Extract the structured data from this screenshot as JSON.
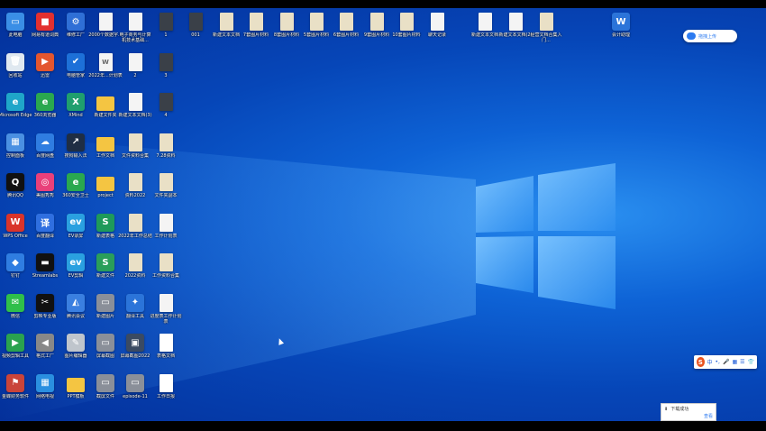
{
  "desktop": {
    "icons": [
      {
        "label": "此电脑",
        "kind": "app",
        "color": "#3a8ee6",
        "glyph": "▭"
      },
      {
        "label": "网易有道词典",
        "kind": "app",
        "color": "#e3302f",
        "glyph": "■"
      },
      {
        "label": "维修工厂",
        "kind": "app",
        "color": "#2f6fd6",
        "glyph": "⚙"
      },
      {
        "label": "2000个数据字...",
        "kind": "doc",
        "color": "#f4f4f4",
        "glyph": ""
      },
      {
        "label": "电子商务与计算机技术基础...",
        "kind": "doc",
        "color": "#f4f4f4",
        "glyph": ""
      },
      {
        "label": "1",
        "kind": "dark",
        "color": "#3a4048",
        "glyph": ""
      },
      {
        "label": "001",
        "kind": "dark",
        "color": "#3a4048",
        "glyph": ""
      },
      {
        "label": "新建文本文档",
        "kind": "zip",
        "color": "#e9e0c6",
        "glyph": ""
      },
      {
        "label": "7套图片材料",
        "kind": "zip",
        "color": "#e9e0c6",
        "glyph": ""
      },
      {
        "label": "8套图片材料",
        "kind": "zip",
        "color": "#e9e0c6",
        "glyph": ""
      },
      {
        "label": "5套图片材料",
        "kind": "zip",
        "color": "#e9e0c6",
        "glyph": ""
      },
      {
        "label": "6套图片材料",
        "kind": "zip",
        "color": "#e9e0c6",
        "glyph": ""
      },
      {
        "label": "9套图片材料",
        "kind": "zip",
        "color": "#e9e0c6",
        "glyph": ""
      },
      {
        "label": "10套图片材料",
        "kind": "zip",
        "color": "#e9e0c6",
        "glyph": ""
      },
      {
        "label": "聊天记录",
        "kind": "doc",
        "color": "#f4f4f4",
        "glyph": ""
      },
      {
        "label": "新建文本文档",
        "kind": "doc",
        "color": "#f4f4f4",
        "glyph": ""
      },
      {
        "label": "新建文本文档(2)",
        "kind": "doc",
        "color": "#f4f4f4",
        "glyph": ""
      },
      {
        "label": "经营文档合集入门...",
        "kind": "zip",
        "color": "#e9e0c6",
        "glyph": ""
      },
      {
        "label": "会计助理",
        "kind": "app",
        "color": "#2b74d9",
        "glyph": "W"
      },
      {
        "label": "回收站",
        "kind": "app",
        "color": "#dfe8f0",
        "glyph": "🗑"
      },
      {
        "label": "迅雷",
        "kind": "app",
        "color": "#e3562f",
        "glyph": "▶"
      },
      {
        "label": "电脑管家",
        "kind": "app",
        "color": "#1d70d8",
        "glyph": "✔"
      },
      {
        "label": "2022年...计划表",
        "kind": "doc",
        "color": "#f4f4f4",
        "glyph": "W"
      },
      {
        "label": "2",
        "kind": "doc",
        "color": "#f4f4f4",
        "glyph": ""
      },
      {
        "label": "3",
        "kind": "dark",
        "color": "#3a4048",
        "glyph": ""
      },
      {
        "label": "Microsoft Edge",
        "kind": "app",
        "color": "#1fa6c9",
        "glyph": "e"
      },
      {
        "label": "360浏览器",
        "kind": "app",
        "color": "#2aa84f",
        "glyph": "e"
      },
      {
        "label": "XMind",
        "kind": "app",
        "color": "#1f9f6e",
        "glyph": "X"
      },
      {
        "label": "新建文件夹",
        "kind": "folder",
        "color": "#f4c542",
        "glyph": ""
      },
      {
        "label": "新建文本文档(3)",
        "kind": "doc",
        "color": "#f4f4f4",
        "glyph": ""
      },
      {
        "label": "4",
        "kind": "dark",
        "color": "#3a4048",
        "glyph": ""
      },
      {
        "label": "控制面板",
        "kind": "app",
        "color": "#4a90e2",
        "glyph": "▦"
      },
      {
        "label": "百度网盘",
        "kind": "app",
        "color": "#2f7de1",
        "glyph": "☁"
      },
      {
        "label": "搜狗输入法",
        "kind": "app",
        "color": "#1f2e44",
        "glyph": "↗"
      },
      {
        "label": "工作文档",
        "kind": "folder",
        "color": "#f4c542",
        "glyph": ""
      },
      {
        "label": "文件资料合集",
        "kind": "zip",
        "color": "#e9e0c6",
        "glyph": ""
      },
      {
        "label": "7.28资料",
        "kind": "zip",
        "color": "#e9e0c6",
        "glyph": ""
      },
      {
        "label": "腾讯QQ",
        "kind": "app",
        "color": "#111111",
        "glyph": "Q"
      },
      {
        "label": "美图秀秀",
        "kind": "app",
        "color": "#e9407a",
        "glyph": "◎"
      },
      {
        "label": "360安全卫士",
        "kind": "app",
        "color": "#2aa84f",
        "glyph": "e"
      },
      {
        "label": "project",
        "kind": "folder",
        "color": "#f4c542",
        "glyph": ""
      },
      {
        "label": "资料2022",
        "kind": "zip",
        "color": "#e9e0c6",
        "glyph": ""
      },
      {
        "label": "文件夹副本",
        "kind": "zip",
        "color": "#e9e0c6",
        "glyph": ""
      },
      {
        "label": "WPS Office",
        "kind": "app",
        "color": "#d9342b",
        "glyph": "W"
      },
      {
        "label": "百度翻译",
        "kind": "app",
        "color": "#2f6fe0",
        "glyph": "译"
      },
      {
        "label": "EV录屏",
        "kind": "app",
        "color": "#2aa0e0",
        "glyph": "ev"
      },
      {
        "label": "新建表格",
        "kind": "app",
        "color": "#1e9a5a",
        "glyph": "S"
      },
      {
        "label": "2022年工作总结",
        "kind": "zip",
        "color": "#e9e0c6",
        "glyph": ""
      },
      {
        "label": "工作计划表",
        "kind": "doc",
        "color": "#f4f4f4",
        "glyph": ""
      },
      {
        "label": "钉钉",
        "kind": "app",
        "color": "#2f7de1",
        "glyph": "◆"
      },
      {
        "label": "Streamlabs",
        "kind": "app",
        "color": "#111111",
        "glyph": "▬"
      },
      {
        "label": "EV剪辑",
        "kind": "app",
        "color": "#2aa0e0",
        "glyph": "ev"
      },
      {
        "label": "新建文件",
        "kind": "app",
        "color": "#2a9e5a",
        "glyph": "S"
      },
      {
        "label": "2022资料",
        "kind": "zip",
        "color": "#e9e0c6",
        "glyph": ""
      },
      {
        "label": "工作资料合集",
        "kind": "zip",
        "color": "#e9e0c6",
        "glyph": ""
      },
      {
        "label": "微信",
        "kind": "app",
        "color": "#2fbf4a",
        "glyph": "✉"
      },
      {
        "label": "剪映专业版",
        "kind": "app",
        "color": "#111111",
        "glyph": "✂"
      },
      {
        "label": "腾讯会议",
        "kind": "app",
        "color": "#3a7fe0",
        "glyph": "◭"
      },
      {
        "label": "新建图片",
        "kind": "app",
        "color": "#8a8f99",
        "glyph": "▭"
      },
      {
        "label": "翻译工具",
        "kind": "app",
        "color": "#2b74d9",
        "glyph": "✦"
      },
      {
        "label": "进度表工作计划表",
        "kind": "doc",
        "color": "#f4f4f4",
        "glyph": ""
      },
      {
        "label": "视频剪辑工具",
        "kind": "app",
        "color": "#2aa24f",
        "glyph": "▶"
      },
      {
        "label": "格式工厂",
        "kind": "app",
        "color": "#888888",
        "glyph": "◀"
      },
      {
        "label": "图片编辑器",
        "kind": "app",
        "color": "#bfc5cc",
        "glyph": "✎"
      },
      {
        "label": "屏幕截图",
        "kind": "app",
        "color": "#8a8f99",
        "glyph": "▭"
      },
      {
        "label": "屏幕截图2022",
        "kind": "app",
        "color": "#3a4a62",
        "glyph": "▣"
      },
      {
        "label": "表格文档",
        "kind": "dark",
        "color": "#ffffff",
        "glyph": "▭"
      },
      {
        "label": "金蝶财务软件",
        "kind": "app",
        "color": "#c9443a",
        "glyph": "⚑"
      },
      {
        "label": "网络电视",
        "kind": "app",
        "color": "#2a8fe0",
        "glyph": "▦"
      },
      {
        "label": "PPT模板",
        "kind": "folder",
        "color": "#f4c542",
        "glyph": ""
      },
      {
        "label": "截屏文件",
        "kind": "app",
        "color": "#8a8f99",
        "glyph": "▭"
      },
      {
        "label": "episode-11",
        "kind": "app",
        "color": "#8a8f99",
        "glyph": "▭"
      },
      {
        "label": "工作日报",
        "kind": "dark",
        "color": "#ffffff",
        "glyph": "▭"
      }
    ]
  },
  "upload_pill": {
    "label": "拖拽上传"
  },
  "ime_bar": {
    "logo": "S",
    "items": [
      "中",
      "•,",
      "🎤",
      "▦",
      "☰",
      "👕"
    ]
  },
  "toast": {
    "title": "下载成功",
    "action": "查看"
  }
}
